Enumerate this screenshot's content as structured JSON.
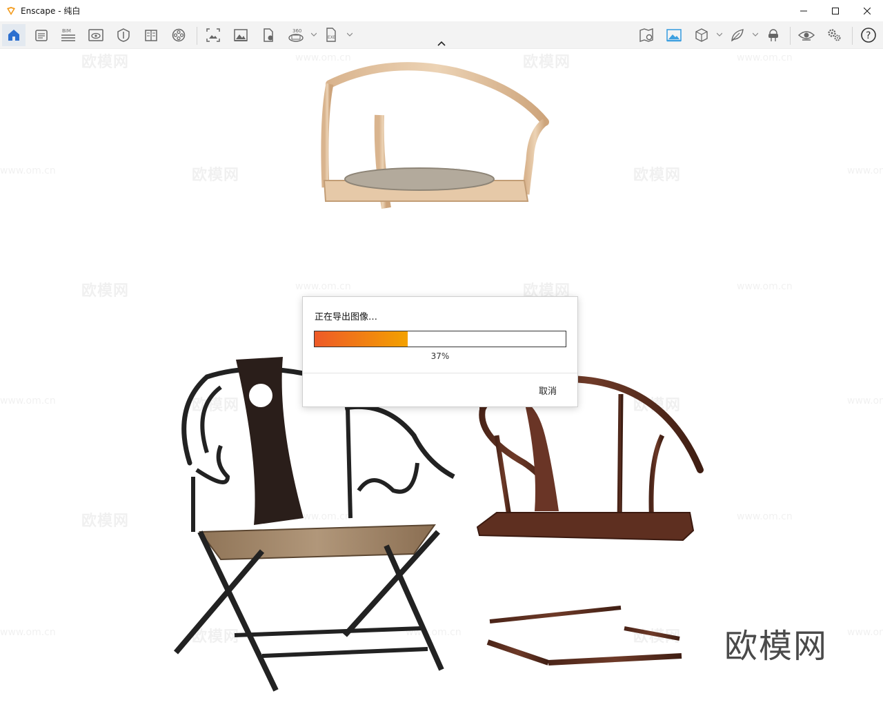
{
  "window": {
    "title": "Enscape - 纯白",
    "controls": [
      "minimize",
      "maximize",
      "close"
    ]
  },
  "toolbar": {
    "left_icons": [
      "home-icon",
      "notes-icon",
      "bim-icon",
      "view-icon",
      "shield-icon",
      "book-icon",
      "film-reel-icon",
      "screenshot-icon",
      "image-icon",
      "file-export-icon",
      "panorama-360-icon",
      "exe-export-icon"
    ],
    "right_icons": [
      "map-icon",
      "landscape-active-icon",
      "cube-icon",
      "leaf-icon",
      "vr-headset-icon",
      "eye-icon",
      "settings-icon",
      "help-icon"
    ],
    "bim_label": "BIM",
    "pano_label": "360",
    "exe_label": "EXE",
    "help_label": "?"
  },
  "viewport": {
    "watermark_text": "欧模网",
    "watermark_url": "www.om.cn",
    "brand_watermark": "欧模网"
  },
  "dialog": {
    "title": "正在导出图像…",
    "progress_percent": 37,
    "progress_text": "37%",
    "cancel_label": "取消"
  },
  "colors": {
    "accent": "#2c6fcf",
    "progress_start": "#ee5a28",
    "progress_end": "#f3a100"
  }
}
